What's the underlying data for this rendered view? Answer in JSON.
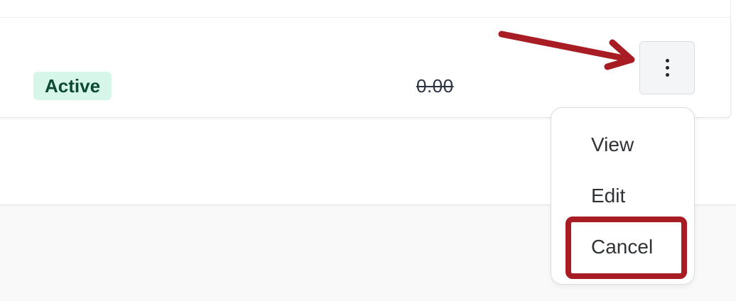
{
  "row": {
    "status": "Active",
    "amount": "0.00"
  },
  "actions_menu": {
    "items": [
      {
        "label": "View"
      },
      {
        "label": "Edit"
      },
      {
        "label": "Cancel"
      }
    ]
  },
  "colors": {
    "badge_bg": "#d6f6ea",
    "badge_text": "#0d4a36",
    "annotation_red": "#a81d24"
  },
  "icons": {
    "actions_button": "more-vertical-icon",
    "annotation": "arrow-icon"
  }
}
